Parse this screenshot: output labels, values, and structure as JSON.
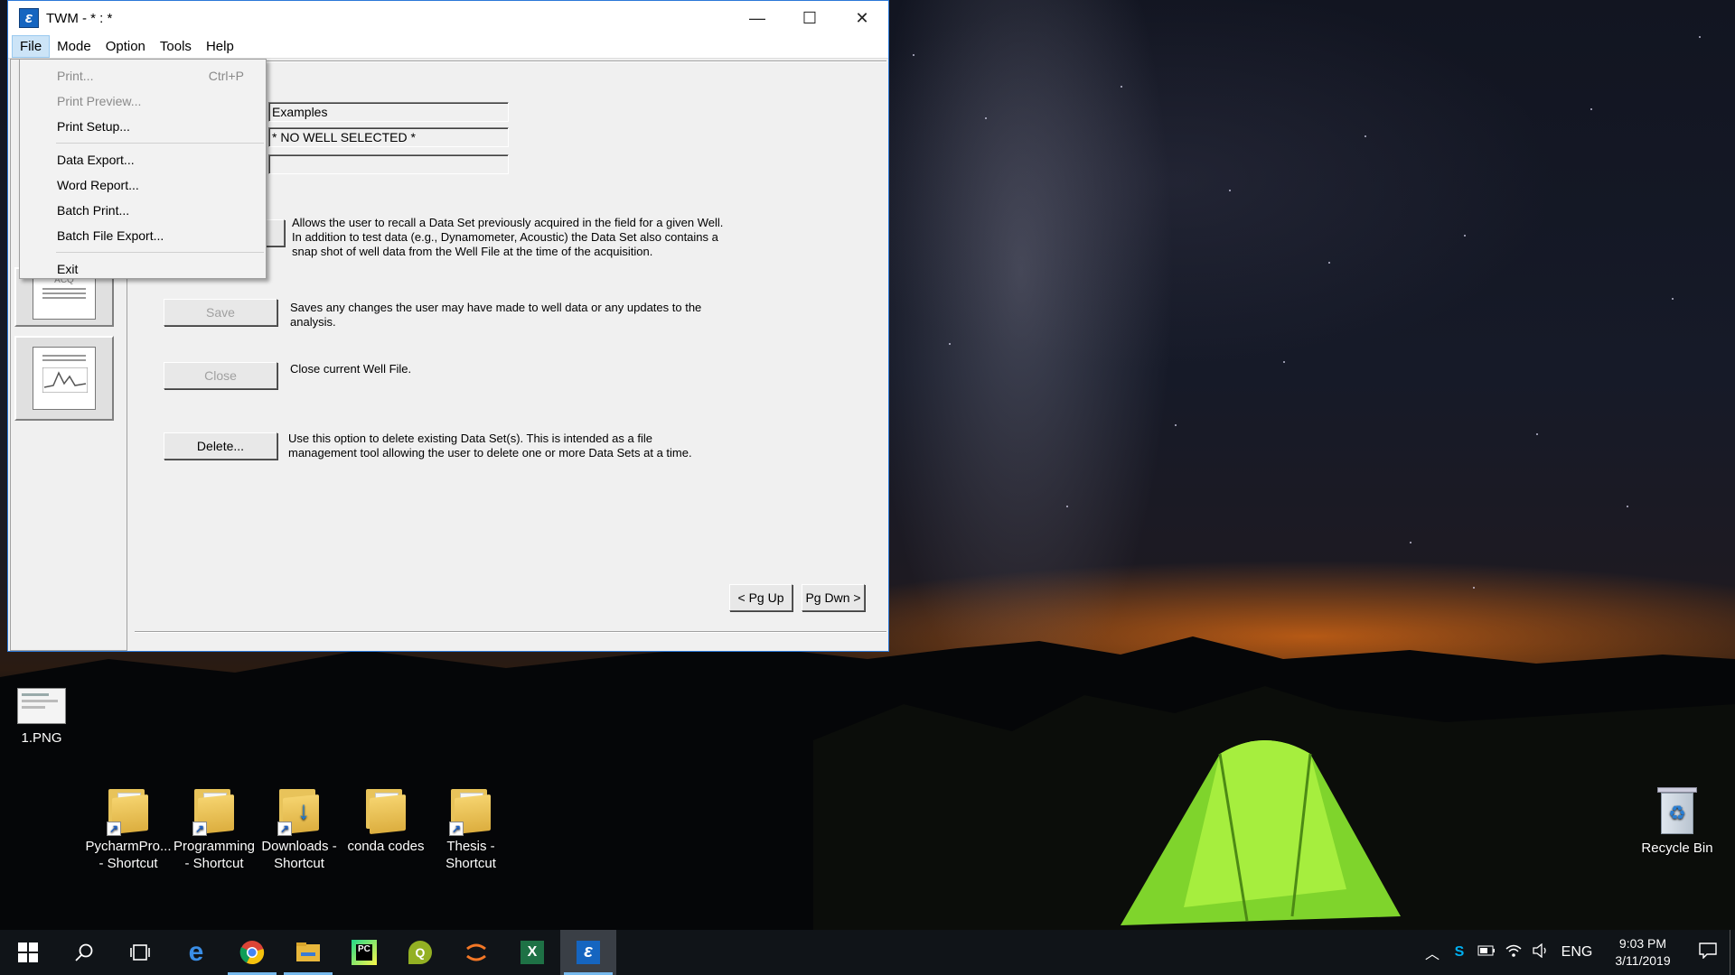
{
  "window": {
    "title": "TWM  -  * : *",
    "controls": {
      "minimize": "—",
      "maximize": "☐",
      "close": "✕"
    }
  },
  "menubar": [
    "File",
    "Mode",
    "Option",
    "Tools",
    "Help"
  ],
  "file_menu": [
    {
      "label": "Print...",
      "shortcut": "Ctrl+P",
      "enabled": false
    },
    {
      "label": "Print Preview...",
      "shortcut": "",
      "enabled": false
    },
    {
      "label": "Print Setup...",
      "shortcut": "",
      "enabled": true
    },
    {
      "label": "Data Export...",
      "shortcut": "",
      "enabled": true
    },
    {
      "label": "Word Report...",
      "shortcut": "",
      "enabled": true
    },
    {
      "label": "Batch Print...",
      "shortcut": "",
      "enabled": true
    },
    {
      "label": "Batch File Export...",
      "shortcut": "",
      "enabled": true
    },
    {
      "label": "Exit",
      "shortcut": "",
      "enabled": true
    }
  ],
  "fields": {
    "group": "Examples",
    "well": "* NO WELL SELECTED *",
    "dataset": ""
  },
  "actions": {
    "recall_desc": "Allows the user to recall a Data Set previously acquired in the field for a given Well.  In addition to test data (e.g.,  Dynamometer, Acoustic) the Data Set also contains a snap shot of well data from the Well File at the time of the acquisition.",
    "save_label": "Save",
    "save_desc": "Saves any changes the user may have made to well data or any updates to the analysis.",
    "close_label": "Close",
    "close_desc": "Close current Well File.",
    "delete_label": "Delete...",
    "delete_desc": "Use this option to delete existing Data Set(s).  This is intended as a file management tool allowing the user to delete one or more Data Sets at a time."
  },
  "left_panel": {
    "acq_label": "ACQ"
  },
  "paging": {
    "pg_up": "< Pg Up",
    "pg_down": "Pg Dwn >"
  },
  "desktop_icons": [
    {
      "label": "1.PNG"
    },
    {
      "label": "PycharmPro... - Shortcut"
    },
    {
      "label": "Programming - Shortcut"
    },
    {
      "label": "Downloads - Shortcut"
    },
    {
      "label": "conda codes"
    },
    {
      "label": "Thesis - Shortcut"
    },
    {
      "label": "Recycle Bin"
    }
  ],
  "taskbar": {
    "lang": "ENG",
    "time": "9:03 PM",
    "date": "3/11/2019"
  }
}
